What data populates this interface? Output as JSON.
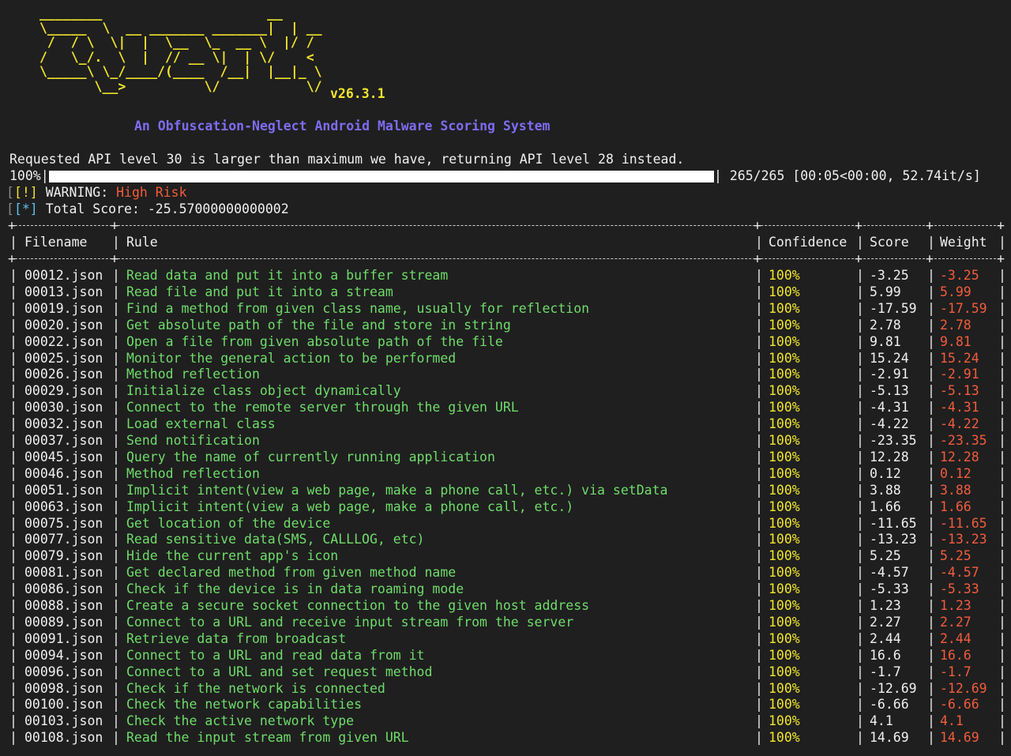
{
  "banner": {
    "ascii_art": "________                     __\n\\_____  \\  __ _______ _______|  | __\n /  / \\  \\|  |  \\__  \\_  __ \\  |/ /\n/   \\_/.  \\  |  // __ \\|  | \\/    <\n\\_____\\ \\_/____/(____  /__|  |__|_ \\\n       \\__>          \\/           \\/",
    "version": "v26.3.1",
    "subtitle": "An Obfuscation-Neglect Android Malware Scoring System"
  },
  "log": {
    "api_message": "Requested API level 30 is larger than maximum we have, returning API level 28 instead.",
    "progress_percent_label": "100%|",
    "progress_fraction": 1.0,
    "progress_stats": "| 265/265 [00:05<00:00, 52.74it/s]",
    "warning_tag": "[!]",
    "warning_label": "WARNING:",
    "warning_value": "High Risk",
    "score_tag": "[*]",
    "score_label": "Total Score:",
    "score_value": "-25.57000000000002"
  },
  "table": {
    "headers": {
      "filename": "Filename",
      "rule": "Rule",
      "confidence": "Confidence",
      "score": "Score",
      "weight": "Weight"
    },
    "rows": [
      {
        "file": "00012.json",
        "rule": "Read data and put it into a buffer stream",
        "conf": "100%",
        "score": "-3.25",
        "weight": "-3.25"
      },
      {
        "file": "00013.json",
        "rule": "Read file and put it into a stream",
        "conf": "100%",
        "score": "5.99",
        "weight": "5.99"
      },
      {
        "file": "00019.json",
        "rule": "Find a method from given class name, usually for reflection",
        "conf": "100%",
        "score": "-17.59",
        "weight": "-17.59"
      },
      {
        "file": "00020.json",
        "rule": "Get absolute path of the file and store in string",
        "conf": "100%",
        "score": "2.78",
        "weight": "2.78"
      },
      {
        "file": "00022.json",
        "rule": "Open a file from given absolute path of the file",
        "conf": "100%",
        "score": "9.81",
        "weight": "9.81"
      },
      {
        "file": "00025.json",
        "rule": "Monitor the general action to be performed",
        "conf": "100%",
        "score": "15.24",
        "weight": "15.24"
      },
      {
        "file": "00026.json",
        "rule": "Method reflection",
        "conf": "100%",
        "score": "-2.91",
        "weight": "-2.91"
      },
      {
        "file": "00029.json",
        "rule": "Initialize class object dynamically",
        "conf": "100%",
        "score": "-5.13",
        "weight": "-5.13"
      },
      {
        "file": "00030.json",
        "rule": "Connect to the remote server through the given URL",
        "conf": "100%",
        "score": "-4.31",
        "weight": "-4.31"
      },
      {
        "file": "00032.json",
        "rule": "Load external class",
        "conf": "100%",
        "score": "-4.22",
        "weight": "-4.22"
      },
      {
        "file": "00037.json",
        "rule": "Send notification",
        "conf": "100%",
        "score": "-23.35",
        "weight": "-23.35"
      },
      {
        "file": "00045.json",
        "rule": "Query the name of currently running application",
        "conf": "100%",
        "score": "12.28",
        "weight": "12.28"
      },
      {
        "file": "00046.json",
        "rule": "Method reflection",
        "conf": "100%",
        "score": "0.12",
        "weight": "0.12"
      },
      {
        "file": "00051.json",
        "rule": "Implicit intent(view a web page, make a phone call, etc.) via setData",
        "conf": "100%",
        "score": "3.88",
        "weight": "3.88"
      },
      {
        "file": "00063.json",
        "rule": "Implicit intent(view a web page, make a phone call, etc.)",
        "conf": "100%",
        "score": "1.66",
        "weight": "1.66"
      },
      {
        "file": "00075.json",
        "rule": "Get location of the device",
        "conf": "100%",
        "score": "-11.65",
        "weight": "-11.65"
      },
      {
        "file": "00077.json",
        "rule": "Read sensitive data(SMS, CALLLOG, etc)",
        "conf": "100%",
        "score": "-13.23",
        "weight": "-13.23"
      },
      {
        "file": "00079.json",
        "rule": "Hide the current app's icon",
        "conf": "100%",
        "score": "5.25",
        "weight": "5.25"
      },
      {
        "file": "00081.json",
        "rule": "Get declared method from given method name",
        "conf": "100%",
        "score": "-4.57",
        "weight": "-4.57"
      },
      {
        "file": "00086.json",
        "rule": "Check if the device is in data roaming mode",
        "conf": "100%",
        "score": "-5.33",
        "weight": "-5.33"
      },
      {
        "file": "00088.json",
        "rule": "Create a secure socket connection to the given host address",
        "conf": "100%",
        "score": "1.23",
        "weight": "1.23"
      },
      {
        "file": "00089.json",
        "rule": "Connect to a URL and receive input stream from the server",
        "conf": "100%",
        "score": "2.27",
        "weight": "2.27"
      },
      {
        "file": "00091.json",
        "rule": "Retrieve data from broadcast",
        "conf": "100%",
        "score": "2.44",
        "weight": "2.44"
      },
      {
        "file": "00094.json",
        "rule": "Connect to a URL and read data from it",
        "conf": "100%",
        "score": "16.6",
        "weight": "16.6"
      },
      {
        "file": "00096.json",
        "rule": "Connect to a URL and set request method",
        "conf": "100%",
        "score": "-1.7",
        "weight": "-1.7"
      },
      {
        "file": "00098.json",
        "rule": "Check if the network is connected",
        "conf": "100%",
        "score": "-12.69",
        "weight": "-12.69"
      },
      {
        "file": "00100.json",
        "rule": "Check the network capabilities",
        "conf": "100%",
        "score": "-6.66",
        "weight": "-6.66"
      },
      {
        "file": "00103.json",
        "rule": "Check the active network type",
        "conf": "100%",
        "score": "4.1",
        "weight": "4.1"
      },
      {
        "file": "00108.json",
        "rule": "Read the input stream from given URL",
        "conf": "100%",
        "score": "14.69",
        "weight": "14.69"
      }
    ]
  },
  "colors": {
    "background": "#1f1f1f",
    "banner": "#f2e52c",
    "subtitle": "#7d6cf4",
    "rule_text": "#6fdc6a",
    "confidence": "#f2e52c",
    "weight": "#f25c3d",
    "risk": "#f25c3d",
    "info_tag": "#5ec3f0"
  }
}
